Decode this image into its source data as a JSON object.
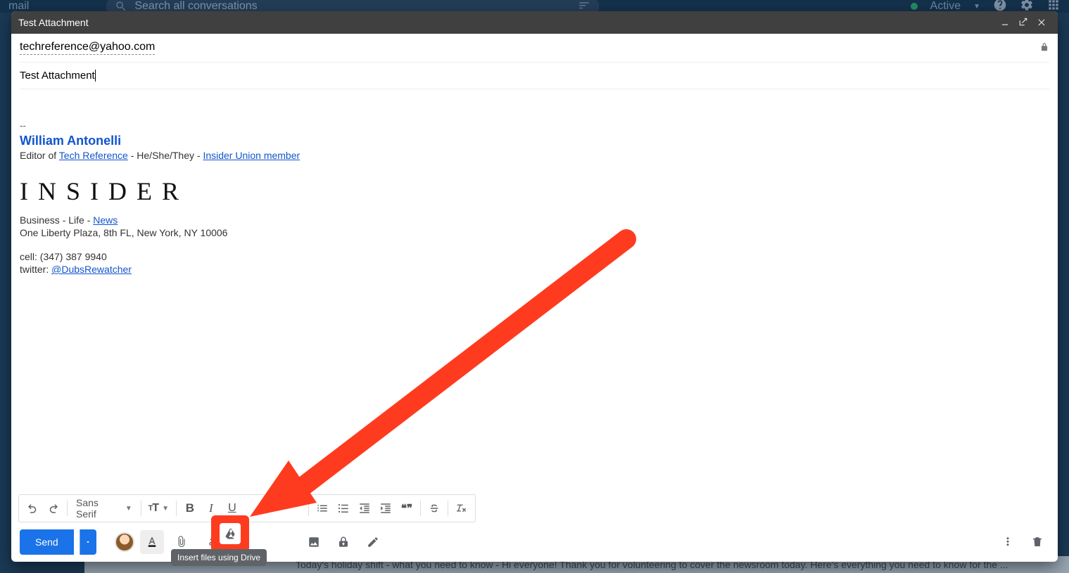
{
  "bg": {
    "mail_label": "mail",
    "search_placeholder": "Search all conversations",
    "status_label": "Active",
    "footer_text": "Today's holiday shift - what you need to know - Hi everyone! Thank you for volunteering to cover the newsroom today. Here's everything you need to know for the ..."
  },
  "compose": {
    "title": "Test Attachment",
    "to": "techreference@yahoo.com",
    "subject": "Test Attachment"
  },
  "signature": {
    "dash": "--",
    "name": "William Antonelli",
    "role_prefix": "Editor of ",
    "role_link": "Tech Reference",
    "pronouns": " - He/She/They - ",
    "union_link": "Insider Union member",
    "logo": "INSIDER",
    "biz_prefix": "Business - Life  - ",
    "biz_link": "News",
    "address": "One Liberty Plaza, 8th FL, New York, NY 10006",
    "cell": "cell: (347) 387 9940",
    "twitter_prefix": "twitter: ",
    "twitter_handle": "@DubsRewatcher"
  },
  "format_toolbar": {
    "font": "Sans Serif",
    "size_label": "тT",
    "bold": "B",
    "italic": "I",
    "underline": "U",
    "quote": "❝❞"
  },
  "send_row": {
    "send_label": "Send"
  },
  "tooltip": {
    "drive": "Insert files using Drive"
  }
}
